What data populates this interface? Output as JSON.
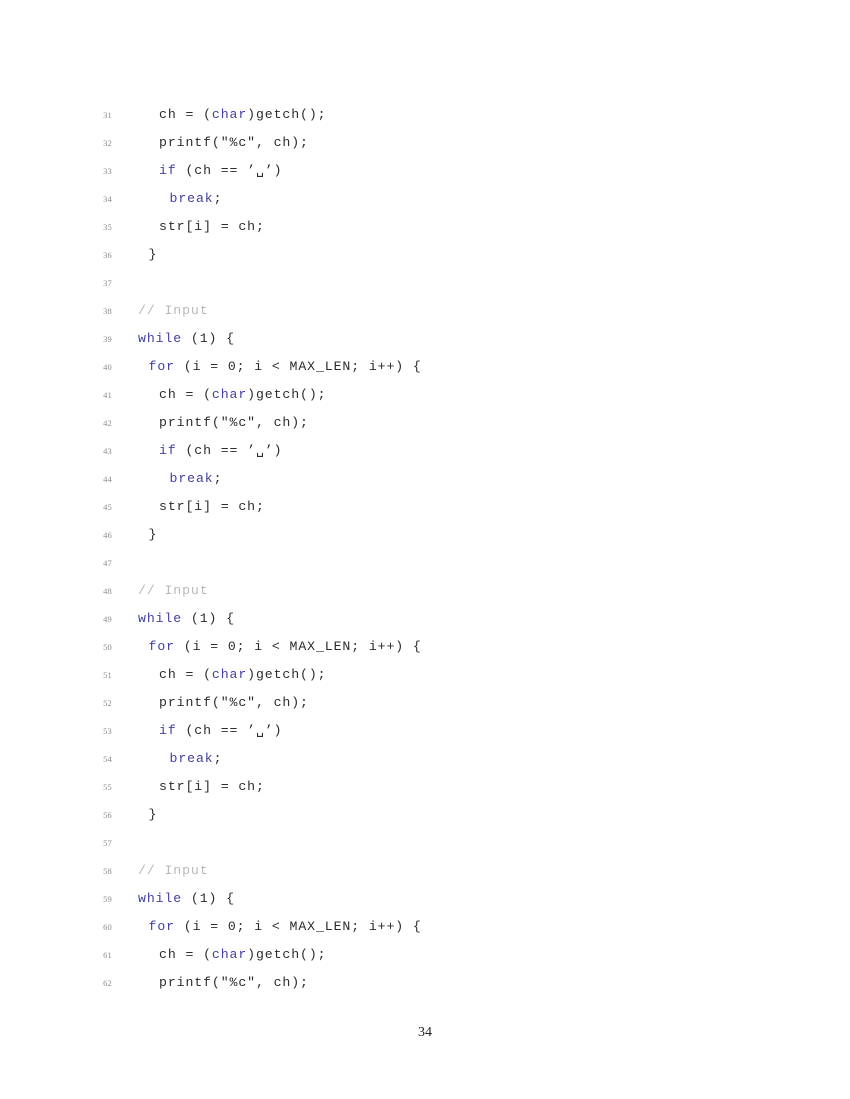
{
  "document": {
    "page_number": "34",
    "colors": {
      "background": "#ffffff",
      "keyword": "#4141a3",
      "comment": "#b9b9b9",
      "plain_code": "#2c2c2c",
      "line_number": "#8a8a8a"
    }
  },
  "listing": {
    "first_line_number": 31,
    "last_line_number": 62,
    "lines": [
      {
        "n": "31",
        "indent": 2,
        "tokens": [
          {
            "t": "ch = (",
            "c": "plain"
          },
          {
            "t": "char",
            "c": "kw"
          },
          {
            "t": ")getch();",
            "c": "plain"
          }
        ]
      },
      {
        "n": "32",
        "indent": 2,
        "tokens": [
          {
            "t": "printf(\"%c\", ch);",
            "c": "plain"
          }
        ]
      },
      {
        "n": "33",
        "indent": 2,
        "tokens": [
          {
            "t": "if",
            "c": "kw"
          },
          {
            "t": " (ch == ",
            "c": "plain"
          },
          {
            "t": "’␣’",
            "c": "plain"
          },
          {
            "t": ")",
            "c": "plain"
          }
        ]
      },
      {
        "n": "34",
        "indent": 3,
        "tokens": [
          {
            "t": "break",
            "c": "kw"
          },
          {
            "t": ";",
            "c": "plain"
          }
        ]
      },
      {
        "n": "35",
        "indent": 2,
        "tokens": [
          {
            "t": "str[i] = ch;",
            "c": "plain"
          }
        ]
      },
      {
        "n": "36",
        "indent": 1,
        "tokens": [
          {
            "t": "}",
            "c": "plain"
          }
        ]
      },
      {
        "n": "37",
        "indent": 0,
        "tokens": []
      },
      {
        "n": "38",
        "indent": 0,
        "tokens": [
          {
            "t": "// Input",
            "c": "cmt"
          }
        ]
      },
      {
        "n": "39",
        "indent": 0,
        "tokens": [
          {
            "t": "while",
            "c": "kw"
          },
          {
            "t": " (1) {",
            "c": "plain"
          }
        ]
      },
      {
        "n": "40",
        "indent": 1,
        "tokens": [
          {
            "t": "for",
            "c": "kw"
          },
          {
            "t": " (i = 0; i < MAX_LEN; i++) {",
            "c": "plain"
          }
        ]
      },
      {
        "n": "41",
        "indent": 2,
        "tokens": [
          {
            "t": "ch = (",
            "c": "plain"
          },
          {
            "t": "char",
            "c": "kw"
          },
          {
            "t": ")getch();",
            "c": "plain"
          }
        ]
      },
      {
        "n": "42",
        "indent": 2,
        "tokens": [
          {
            "t": "printf(\"%c\", ch);",
            "c": "plain"
          }
        ]
      },
      {
        "n": "43",
        "indent": 2,
        "tokens": [
          {
            "t": "if",
            "c": "kw"
          },
          {
            "t": " (ch == ",
            "c": "plain"
          },
          {
            "t": "’␣’",
            "c": "plain"
          },
          {
            "t": ")",
            "c": "plain"
          }
        ]
      },
      {
        "n": "44",
        "indent": 3,
        "tokens": [
          {
            "t": "break",
            "c": "kw"
          },
          {
            "t": ";",
            "c": "plain"
          }
        ]
      },
      {
        "n": "45",
        "indent": 2,
        "tokens": [
          {
            "t": "str[i] = ch;",
            "c": "plain"
          }
        ]
      },
      {
        "n": "46",
        "indent": 1,
        "tokens": [
          {
            "t": "}",
            "c": "plain"
          }
        ]
      },
      {
        "n": "47",
        "indent": 0,
        "tokens": []
      },
      {
        "n": "48",
        "indent": 0,
        "tokens": [
          {
            "t": "// Input",
            "c": "cmt"
          }
        ]
      },
      {
        "n": "49",
        "indent": 0,
        "tokens": [
          {
            "t": "while",
            "c": "kw"
          },
          {
            "t": " (1) {",
            "c": "plain"
          }
        ]
      },
      {
        "n": "50",
        "indent": 1,
        "tokens": [
          {
            "t": "for",
            "c": "kw"
          },
          {
            "t": " (i = 0; i < MAX_LEN; i++) {",
            "c": "plain"
          }
        ]
      },
      {
        "n": "51",
        "indent": 2,
        "tokens": [
          {
            "t": "ch = (",
            "c": "plain"
          },
          {
            "t": "char",
            "c": "kw"
          },
          {
            "t": ")getch();",
            "c": "plain"
          }
        ]
      },
      {
        "n": "52",
        "indent": 2,
        "tokens": [
          {
            "t": "printf(\"%c\", ch);",
            "c": "plain"
          }
        ]
      },
      {
        "n": "53",
        "indent": 2,
        "tokens": [
          {
            "t": "if",
            "c": "kw"
          },
          {
            "t": " (ch == ",
            "c": "plain"
          },
          {
            "t": "’␣’",
            "c": "plain"
          },
          {
            "t": ")",
            "c": "plain"
          }
        ]
      },
      {
        "n": "54",
        "indent": 3,
        "tokens": [
          {
            "t": "break",
            "c": "kw"
          },
          {
            "t": ";",
            "c": "plain"
          }
        ]
      },
      {
        "n": "55",
        "indent": 2,
        "tokens": [
          {
            "t": "str[i] = ch;",
            "c": "plain"
          }
        ]
      },
      {
        "n": "56",
        "indent": 1,
        "tokens": [
          {
            "t": "}",
            "c": "plain"
          }
        ]
      },
      {
        "n": "57",
        "indent": 0,
        "tokens": []
      },
      {
        "n": "58",
        "indent": 0,
        "tokens": [
          {
            "t": "// Input",
            "c": "cmt"
          }
        ]
      },
      {
        "n": "59",
        "indent": 0,
        "tokens": [
          {
            "t": "while",
            "c": "kw"
          },
          {
            "t": " (1) {",
            "c": "plain"
          }
        ]
      },
      {
        "n": "60",
        "indent": 1,
        "tokens": [
          {
            "t": "for",
            "c": "kw"
          },
          {
            "t": " (i = 0; i < MAX_LEN; i++) {",
            "c": "plain"
          }
        ]
      },
      {
        "n": "61",
        "indent": 2,
        "tokens": [
          {
            "t": "ch = (",
            "c": "plain"
          },
          {
            "t": "char",
            "c": "kw"
          },
          {
            "t": ")getch();",
            "c": "plain"
          }
        ]
      },
      {
        "n": "62",
        "indent": 2,
        "tokens": [
          {
            "t": "printf(\"%c\", ch);",
            "c": "plain"
          }
        ]
      }
    ]
  }
}
